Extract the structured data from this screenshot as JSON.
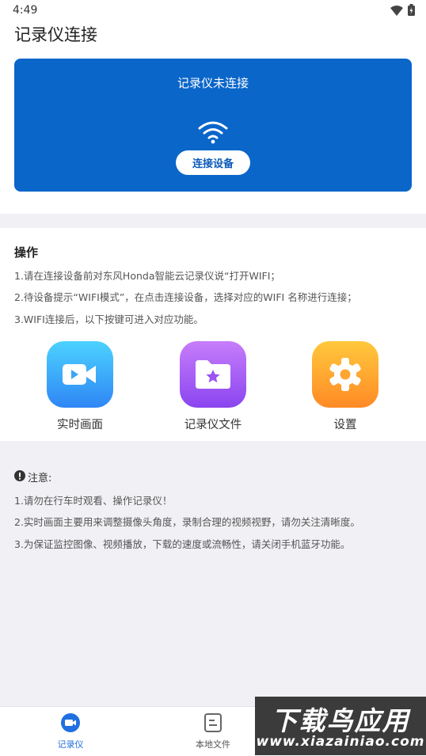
{
  "status_bar": {
    "time": "4:49"
  },
  "page": {
    "title": "记录仪连接"
  },
  "connection_card": {
    "status": "记录仪未连接",
    "connect_button": "连接设备"
  },
  "operations": {
    "title": "操作",
    "lines": [
      "1.请在连接设备前对东风Honda智能云记录仪说“打开WIFI；",
      "2.待设备提示“WIFI模式”，在点击连接设备，选择对应的WIFI 名称进行连接；",
      "3.WIFI连接后，以下按键可进入对应功能。"
    ],
    "features": [
      {
        "label": "实时画面",
        "icon": "video-camera-icon",
        "color_top": "#4cd2ff",
        "color_bottom": "#2f86f5"
      },
      {
        "label": "记录仪文件",
        "icon": "folder-star-icon",
        "color_top": "#c77dfa",
        "color_bottom": "#8a45f0"
      },
      {
        "label": "设置",
        "icon": "gear-icon",
        "color_top": "#ffc83c",
        "color_bottom": "#ff8a26"
      }
    ]
  },
  "notes": {
    "title": "注意:",
    "lines": [
      "1.请勿在行车时观看、操作记录仪！",
      "2.实时画面主要用来调整摄像头角度，录制合理的视频视野，请勿关注清晰度。",
      "3.为保证监控图像、视频播放，下载的速度或流畅性，请关闭手机蓝牙功能。"
    ]
  },
  "bottom_nav": {
    "items": [
      {
        "label": "记录仪",
        "icon": "camera-circle-icon",
        "active": true
      },
      {
        "label": "本地文件",
        "icon": "document-icon",
        "active": false
      }
    ],
    "active_color": "#1f6fe0",
    "inactive_color": "#555555"
  },
  "watermark": {
    "title": "下载鸟应用",
    "url": "www.xiazainiao.com"
  }
}
